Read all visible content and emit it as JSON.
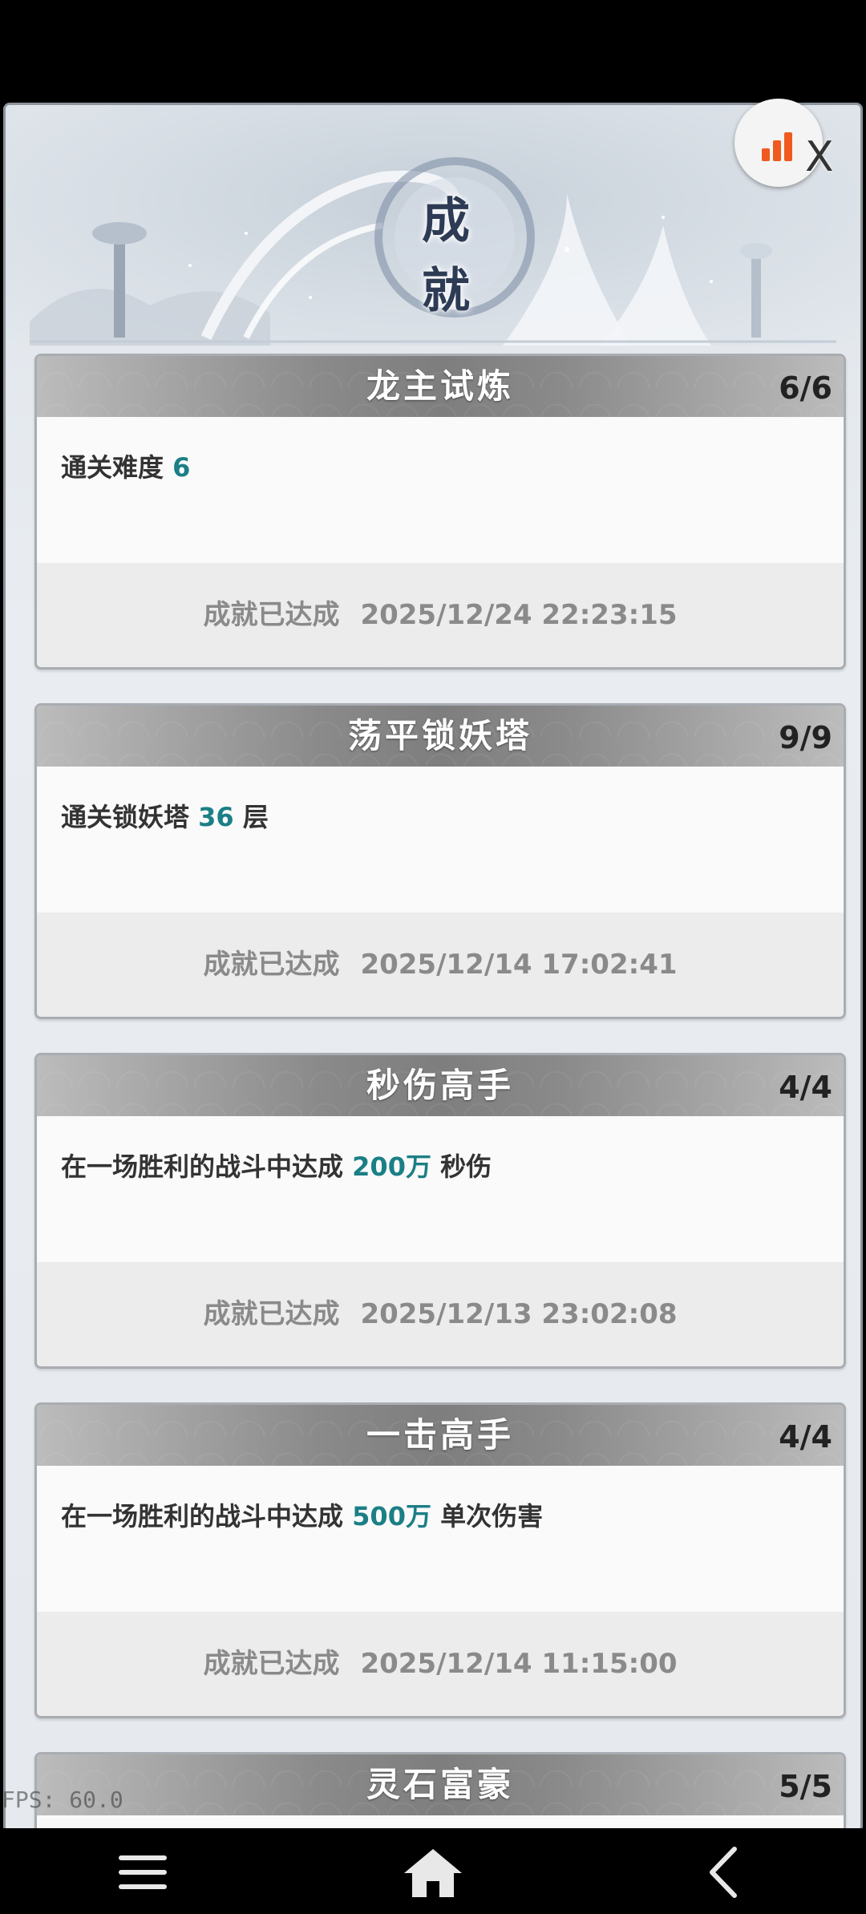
{
  "page": {
    "title": "成就"
  },
  "icons": {
    "stats": "bar-chart-icon",
    "close": "close-icon",
    "menu": "menu-icon",
    "home": "home-icon",
    "back": "back-icon"
  },
  "close_label": "X",
  "fps": "FPS: 60.0",
  "colors": {
    "highlight": "#1b7f86",
    "header_bar": "#7e7e7e",
    "stats_orange": "#ef5a1f"
  },
  "achievements": [
    {
      "title": "龙主试炼",
      "progress": "6/6",
      "desc_prefix": "通关难度 ",
      "desc_value": "6",
      "desc_suffix": "",
      "status": "成就已达成",
      "time": "2025/12/24 22:23:15"
    },
    {
      "title": "荡平锁妖塔",
      "progress": "9/9",
      "desc_prefix": "通关锁妖塔 ",
      "desc_value": "36",
      "desc_suffix": " 层",
      "status": "成就已达成",
      "time": "2025/12/14 17:02:41"
    },
    {
      "title": "秒伤高手",
      "progress": "4/4",
      "desc_prefix": "在一场胜利的战斗中达成 ",
      "desc_value": "200万",
      "desc_suffix": " 秒伤",
      "status": "成就已达成",
      "time": "2025/12/13 23:02:08"
    },
    {
      "title": "一击高手",
      "progress": "4/4",
      "desc_prefix": "在一场胜利的战斗中达成 ",
      "desc_value": "500万",
      "desc_suffix": " 单次伤害",
      "status": "成就已达成",
      "time": "2025/12/14 11:15:00"
    },
    {
      "title": "灵石富豪",
      "progress": "5/5"
    }
  ]
}
